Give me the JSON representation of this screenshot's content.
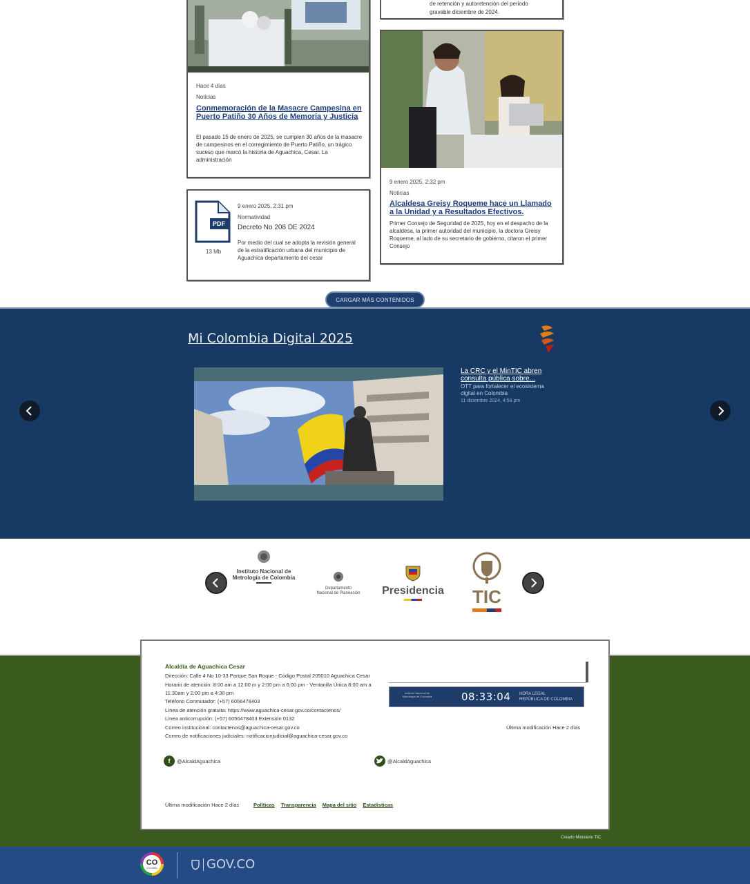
{
  "news": {
    "card_top_right_snippet": {
      "line1": "de retención y autoretención del periodo",
      "line2": "gravable diciembre de 2024."
    },
    "card_masacre": {
      "time": "Hace 4 días",
      "category": "Noticias",
      "title": "Conmemoración de la Masacre Campesina en Puerto Patiño 30 Años de Memoria y Justicia",
      "description": "El pasado 15 de enero de 2025, se cumplen 30 años de la masacre de campesinos en el corregimiento de Puerto Patiño, un trágico suceso que marcó la historia de Aguachica, Cesar. La administración"
    },
    "card_decreto": {
      "file_type": "PDF",
      "file_size": "13 Mb",
      "time": "9 enero 2025, 2:31 pm",
      "category": "Normatividad",
      "title": "Decreto No 208 DE 2024",
      "description": "Por medio del cual se adopta la revisión general de la estratificación urbana del municipio de Aguachica departamento del cesar"
    },
    "card_alcaldesa": {
      "time": "9 enero 2025, 2:32 pm",
      "category": "Noticias",
      "title": "Alcaldesa Greisy Roqueme hace un Llamado a la Unidad y a Resultados Efectivos.",
      "description": "Primer Consejo de Seguridad de 2025, hoy en el despacho de la alcaldesa, la primer autoridad del municipio, la doctora Greisy Roqueme, al lado de su secretario de gobierno, citaron el primer Consejo"
    },
    "load_more_label": "CARGAR MÁS CONTENIDOS"
  },
  "mi_colombia_digital": {
    "title": "Mi Colombia Digital 2025",
    "item": {
      "title": "La CRC y el MinTIC abren consulta pública sobre...",
      "description": "OTT para fortalecer el ecosistema digital en Colombia",
      "date": "11 diciembre 2024, 4:58 pm"
    },
    "prev_icon": "chevron-left-icon",
    "next_icon": "chevron-right-icon"
  },
  "logos": {
    "items": [
      {
        "name": "Instituto Nacional de Metrología de Colombia",
        "line1": "Instituto Nacional de",
        "line2": "Metrología de Colombia"
      },
      {
        "name": "Departamento Nacional de Planeación",
        "line1": "Departamento",
        "line2": "Nacional de Planeación"
      },
      {
        "name": "Presidencia",
        "line1": "Presidencia"
      },
      {
        "name": "TIC",
        "line1": "TIC"
      }
    ]
  },
  "footer": {
    "org_name": "Alcaldía de Aguachica Cesar",
    "lines": [
      "Dirección: Calle 4 No 10-33 Parque San Roque - Código Postal 205010 Aguachica Cesar",
      "Horario de atención: 8:00 am a 12:00 m y 2:00 pm a 6:00 pm - Ventanilla Única 8:00 am a",
      "11:30am y 2:00 pm a 4:30 pm",
      "Teléfono Conmutador: (+57) 6056478403",
      "Línea de atención gratuita: https://www.aguachica-cesar.gov.co/contactenos/",
      "Línea anticorrupción: (+57) 6056478403 Extensión 0132",
      "Correo institucional: contactenos@aguachica-cesar.gov.co",
      "Correo de notificaciones judiciales: notificacionjudicial@aguachica-cesar.gov.co"
    ],
    "clock": {
      "time": "08:33:04",
      "label_line1": "HORA LEGAL",
      "label_line2": "REPÚBLICA DE COLOMBIA",
      "institute_line1": "Instituto Nacional de",
      "institute_line2": "Metrología de Colombia"
    },
    "last_modified_right": "Última modificación Hace 2 días",
    "facebook_handle": "@AlcaldAguachica",
    "twitter_handle": "@AlcaldAguachica",
    "last_modified_bottom": "Última modificación Hace 2 días",
    "links": [
      "Políticas",
      "Transparencia",
      "Mapa del sitio",
      "Estadísticas"
    ],
    "credit": "Creado Ministerio TIC"
  },
  "gov_bar": {
    "co_label": "CO",
    "co_sub": "COLOMBIA",
    "gov_label": "GOV.CO"
  }
}
